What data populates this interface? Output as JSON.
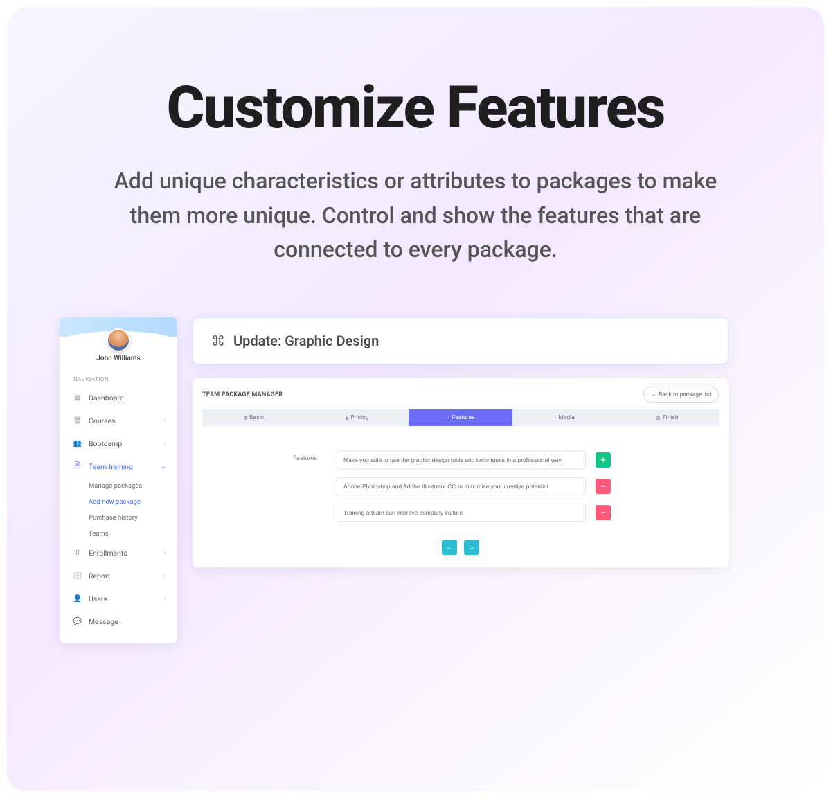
{
  "hero": {
    "title": "Customize Features",
    "subtitle": "Add unique characteristics or attributes to packages to make them more unique. Control and show the features that are connected to every package."
  },
  "sidebar": {
    "user_name": "John Williams",
    "nav_heading": "NAVIGATION",
    "items": [
      {
        "label": "Dashboard",
        "expandable": false
      },
      {
        "label": "Courses",
        "expandable": true
      },
      {
        "label": "Bootcamp",
        "expandable": true
      },
      {
        "label": "Team training",
        "expandable": true,
        "active": true
      },
      {
        "label": "Enrollments",
        "expandable": true
      },
      {
        "label": "Report",
        "expandable": true
      },
      {
        "label": "Users",
        "expandable": true
      },
      {
        "label": "Message",
        "expandable": false
      }
    ],
    "sub_items": [
      {
        "label": "Manage packages"
      },
      {
        "label": "Add new package",
        "active": true
      },
      {
        "label": "Purchase history"
      },
      {
        "label": "Teams"
      }
    ]
  },
  "top_panel": {
    "title": "Update: Graphic Design"
  },
  "main": {
    "title": "TEAM PACKAGE MANAGER",
    "back_label": "Back to package list",
    "tabs": [
      {
        "label": "Basic"
      },
      {
        "label": "Pricing"
      },
      {
        "label": "Features",
        "active": true
      },
      {
        "label": "Media"
      },
      {
        "label": "Finish"
      }
    ],
    "form_label": "Features",
    "features": [
      "Make you able to use the graphic design tools and techniques in a professional way",
      "Adobe Photoshop and Adobe Illustrator CC to maximize your creative potential",
      "Training a team can improve company culture"
    ]
  }
}
